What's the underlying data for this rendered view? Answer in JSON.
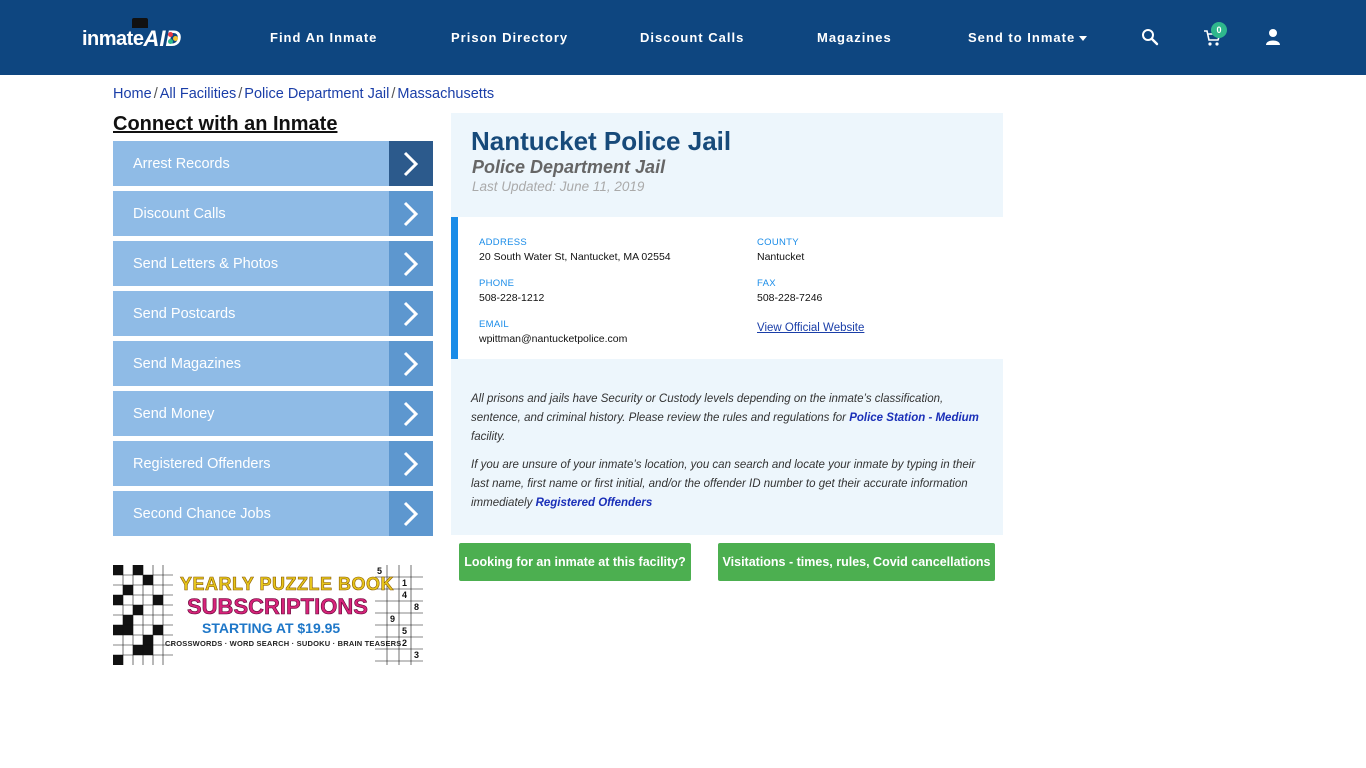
{
  "nav": {
    "logo_text": "inmate",
    "logo_aid": "AID",
    "items": [
      "Find An Inmate",
      "Prison Directory",
      "Discount Calls",
      "Magazines",
      "Send to Inmate"
    ],
    "cart_count": "0"
  },
  "breadcrumb": [
    "Home",
    "All Facilities",
    "Police Department Jail",
    "Massachusetts"
  ],
  "sidebar": {
    "title": "Connect with an Inmate",
    "items": [
      "Arrest Records",
      "Discount Calls",
      "Send Letters & Photos",
      "Send Postcards",
      "Send Magazines",
      "Send Money",
      "Registered Offenders",
      "Second Chance Jobs"
    ]
  },
  "ad": {
    "line1": "YEARLY PUZZLE BOOK",
    "line2": "SUBSCRIPTIONS",
    "line3": "STARTING AT $19.95",
    "line4": "CROSSWORDS · WORD SEARCH · SUDOKU · BRAIN TEASERS",
    "digits": [
      "5",
      "1",
      "4",
      "9",
      "5",
      "2",
      "3",
      "8"
    ]
  },
  "facility": {
    "name": "Nantucket Police Jail",
    "type": "Police Department Jail",
    "updated": "Last Updated: June 11, 2019",
    "address_label": "ADDRESS",
    "address": "20 South Water St, Nantucket, MA 02554",
    "county_label": "COUNTY",
    "county": "Nantucket",
    "phone_label": "PHONE",
    "phone": "508-228-1212",
    "fax_label": "FAX",
    "fax": "508-228-7246",
    "email_label": "EMAIL",
    "email": "wpittman@nantucketpolice.com",
    "website_link": "View Official Website"
  },
  "para1": {
    "text": "All prisons and jails have Security or Custody levels depending on the inmate’s classification, sentence, and criminal history. Please review the rules and regulations for ",
    "link": "Police Station - Medium",
    "suffix": " facility."
  },
  "para2": {
    "text": "If you are unsure of your inmate’s location, you can search and locate your inmate by typing in their last name, first name or first initial, and/or the offender ID number to get their accurate information immediately ",
    "link": "Registered Offenders"
  },
  "buttons": {
    "looking": "Looking for an inmate at this facility?",
    "visitations": "Visitations - times, rules, Covid cancellations"
  },
  "colors": {
    "nav_bg": "#0e4680",
    "sidebar_item": "#8fbbe6",
    "sidebar_arrow": "#5d97cf",
    "accent_blue": "#1a8ce8",
    "button_green": "#4caf50"
  }
}
